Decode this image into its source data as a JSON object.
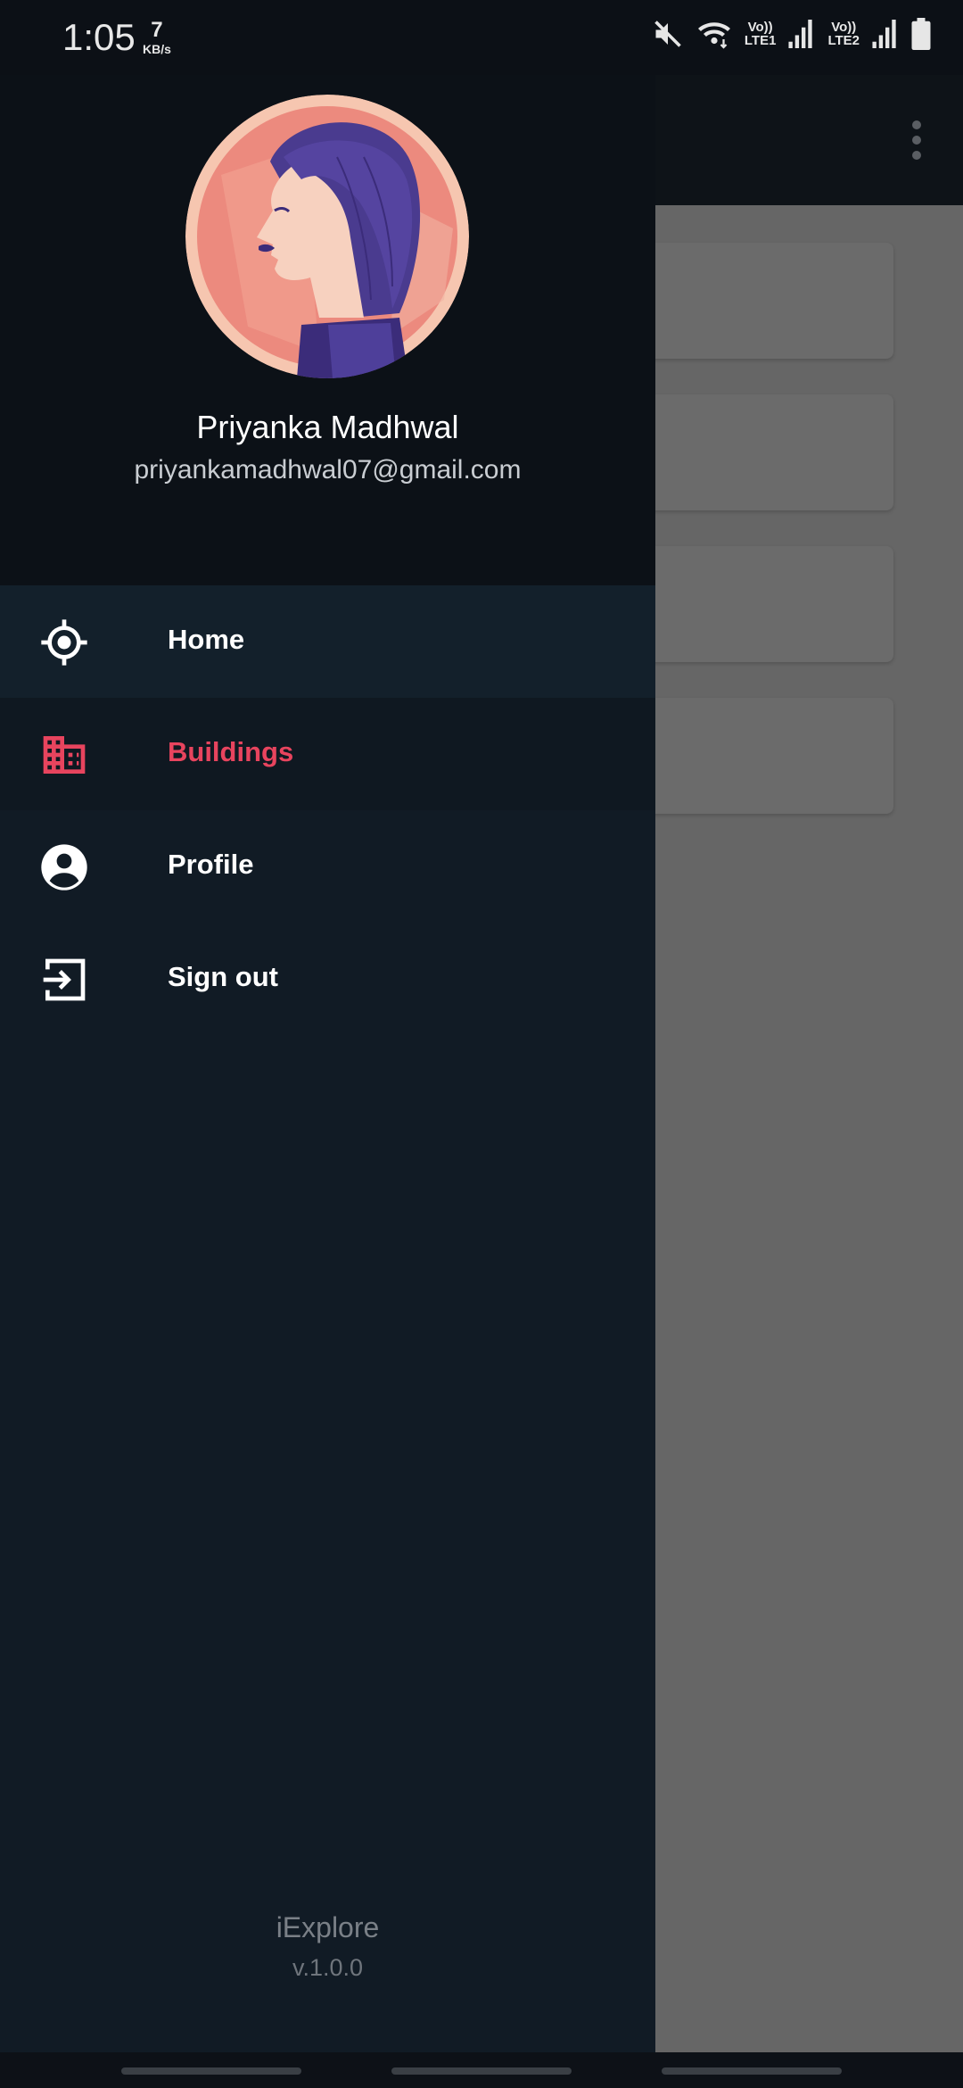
{
  "status_bar": {
    "time": "1:05",
    "speed_value": "7",
    "speed_unit": "KB/s",
    "sim1_label_top": "Vo))",
    "sim1_label_bottom": "LTE1",
    "sim2_label_top": "Vo))",
    "sim2_label_bottom": "LTE2",
    "icons": [
      "mute-icon",
      "wifi-icon",
      "signal-icon",
      "signal-icon",
      "battery-icon"
    ]
  },
  "toolbar": {
    "menu_icon": "more-vert-icon"
  },
  "drawer": {
    "user_name": "Priyanka Madhwal",
    "user_email": "priyankamadhwal07@gmail.com",
    "items": [
      {
        "label": "Home",
        "icon": "target-icon",
        "active": false
      },
      {
        "label": "Buildings",
        "icon": "building-icon",
        "active": true
      },
      {
        "label": "Profile",
        "icon": "account-circle-icon",
        "active": false
      },
      {
        "label": "Sign out",
        "icon": "sign-out-icon",
        "active": false
      }
    ],
    "footer_app_name": "iExplore",
    "footer_version": "v.1.0.0"
  },
  "colors": {
    "accent": "#e8445e",
    "drawer_bg": "#111b25",
    "header_bg": "#0c1117",
    "scrim": "#666666"
  }
}
